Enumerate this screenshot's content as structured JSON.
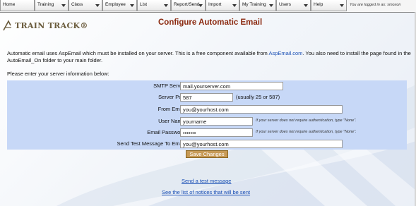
{
  "menu": {
    "items": [
      {
        "label": "Home",
        "has_dropdown": false
      },
      {
        "label": "Training",
        "has_dropdown": true
      },
      {
        "label": "Class",
        "has_dropdown": true
      },
      {
        "label": "Employee",
        "has_dropdown": true
      },
      {
        "label": "List",
        "has_dropdown": true
      },
      {
        "label": "Report/Send",
        "has_dropdown": true
      },
      {
        "label": "Import",
        "has_dropdown": true
      },
      {
        "label": "My Training",
        "has_dropdown": true
      },
      {
        "label": "Users",
        "has_dropdown": true
      },
      {
        "label": "Help",
        "has_dropdown": true
      }
    ],
    "logged_in_text": "You are logged in as: smoxon"
  },
  "logo": {
    "text": "TRAIN TRACK®",
    "icon": "triangle-logo-icon"
  },
  "page": {
    "title": "Configure Automatic Email",
    "intro_part1": "Automatic email uses AspEmail which must be installed on your server. This is a free component available from ",
    "intro_link": "AspEmail.com",
    "intro_part2": ". You also need to install the page found in the AutoEmail_On folder to your main folder.",
    "prompt": "Please enter your server information below:"
  },
  "form": {
    "smtp_label": "SMTP Server",
    "smtp_value": "mail.yourserver.com",
    "port_label": "Server Port",
    "port_value": "587",
    "port_note": "(usually 25 or 587)",
    "from_label": "From Email",
    "from_value": "you@yourhost.com",
    "user_label": "User Name",
    "user_value": "yourname",
    "user_hint": "If your server does not require authentication, type \"None\".",
    "password_label": "Email Password",
    "password_value": "•••••••",
    "password_hint": "If your server does not require authentication, type \"None\".",
    "test_label": "Send Test Message To Email",
    "test_value": "you@yourhost.com",
    "save_label": "Save Changes"
  },
  "links": {
    "send_test": "Send a test message",
    "notices": "See the list of notices that will be sent"
  },
  "colors": {
    "title": "#8b2a10",
    "form_bg": "#c7d8f7",
    "link": "#1a4fb5",
    "button": "#c79a56"
  }
}
